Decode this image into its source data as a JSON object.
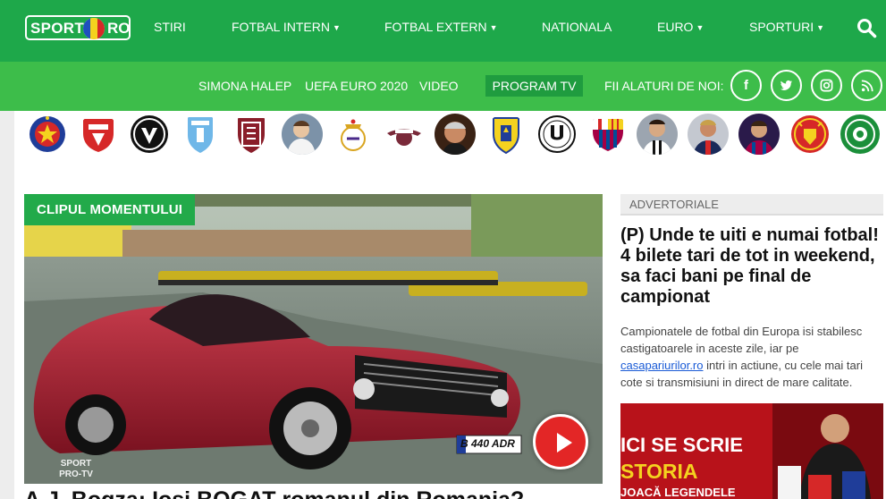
{
  "header": {
    "logo_left": "SPORT",
    "logo_right": "RO",
    "nav": [
      {
        "label": "STIRI",
        "has_caret": false
      },
      {
        "label": "FOTBAL INTERN",
        "has_caret": true
      },
      {
        "label": "FOTBAL EXTERN",
        "has_caret": true
      },
      {
        "label": "NATIONALA",
        "has_caret": false
      },
      {
        "label": "EURO",
        "has_caret": true
      },
      {
        "label": "SPORTURI",
        "has_caret": true
      }
    ],
    "search_icon": "search-icon"
  },
  "subnav": {
    "items": [
      "SIMONA HALEP",
      "UEFA EURO 2020",
      "VIDEO"
    ],
    "program_tv": "PROGRAM TV",
    "social_label": "FII ALATURI DE NOI:",
    "social_icons": [
      "facebook-icon",
      "twitter-icon",
      "instagram-icon",
      "rss-icon"
    ]
  },
  "teams": [
    {
      "name": "steaua-logo"
    },
    {
      "name": "dinamo-logo"
    },
    {
      "name": "viitorul-logo"
    },
    {
      "name": "craiova-logo"
    },
    {
      "name": "cfr-logo"
    },
    {
      "name": "simona-halep-photo"
    },
    {
      "name": "real-madrid-logo"
    },
    {
      "name": "rapid-logo"
    },
    {
      "name": "gigi-becali-photo"
    },
    {
      "name": "petrolul-logo"
    },
    {
      "name": "u-cluj-logo"
    },
    {
      "name": "barcelona-logo"
    },
    {
      "name": "ronaldo-photo"
    },
    {
      "name": "neymar-photo"
    },
    {
      "name": "messi-photo"
    },
    {
      "name": "manchester-united-logo"
    },
    {
      "name": "gaz-metan-logo"
    }
  ],
  "hero": {
    "label": "CLIPUL MOMENTULUI",
    "plate": "B 440 ADR",
    "watermark_top": "SPORT",
    "watermark_bottom": "PRO-TV",
    "title": "A.J. Bogza: Iosi BOGAT romanul din Romania?"
  },
  "advertorial": {
    "header": "ADVERTORIALE",
    "title": "(P) Unde te uiti e numai fotbal! 4 bilete tari de tot in weekend, sa faci bani pe final de campionat",
    "text_before": "Campionatele de fotbal din Europa isi stabilesc castigatoarele in aceste zile, iar pe ",
    "link": "casapariurilor.ro",
    "text_after": " intri in actiune, cu cele mai tari cote si transmisiuni in direct de mare calitate.",
    "promo_line1": "ICI SE SCRIE",
    "promo_line2": "STORIA",
    "promo_line3": "JOACĂ LEGENDELE"
  },
  "colors": {
    "brand_green": "#1ea84a",
    "sub_green": "#3dbd4a",
    "play_red": "#e32626"
  }
}
